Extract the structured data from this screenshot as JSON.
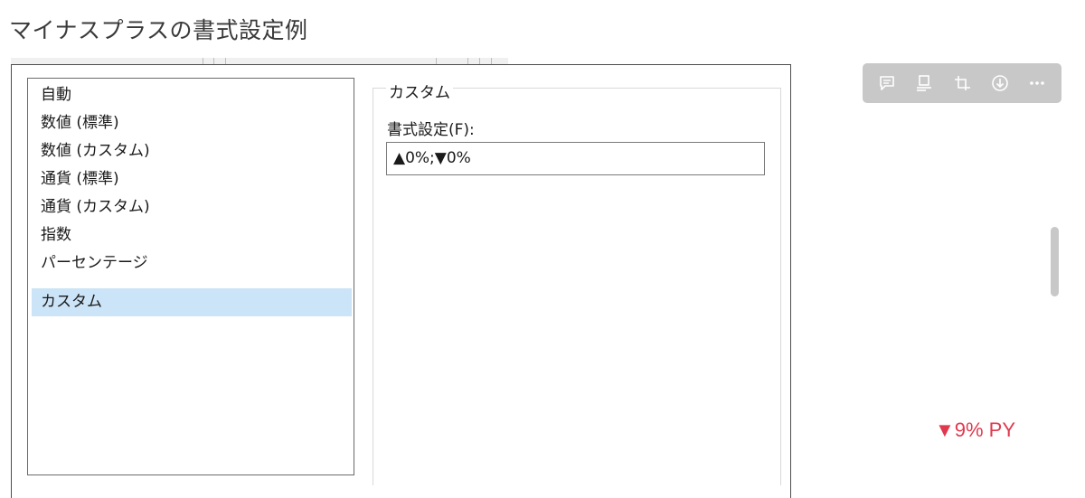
{
  "page": {
    "title": "マイナスプラスの書式設定例"
  },
  "format_list": {
    "items": [
      {
        "label": "自動"
      },
      {
        "label": "数値 (標準)"
      },
      {
        "label": "数値 (カスタム)"
      },
      {
        "label": "通貨 (標準)"
      },
      {
        "label": "通貨 (カスタム)"
      },
      {
        "label": "指数"
      },
      {
        "label": "パーセンテージ"
      },
      {
        "label": "カスタム"
      }
    ],
    "selected": "カスタム"
  },
  "custom_group": {
    "legend": "カスタム",
    "format_label": "書式設定(F):",
    "format_value": "▲0%;▼0%"
  },
  "toolbar": {
    "buttons": [
      "comment-icon",
      "align-bottom-icon",
      "crop-icon",
      "download-icon",
      "more-icon"
    ]
  },
  "indicator": {
    "text": "▼9% PY",
    "color": "#e0394d"
  },
  "colors": {
    "selection": "#cce4f7",
    "toolbar_bg": "#c8c8c8"
  }
}
